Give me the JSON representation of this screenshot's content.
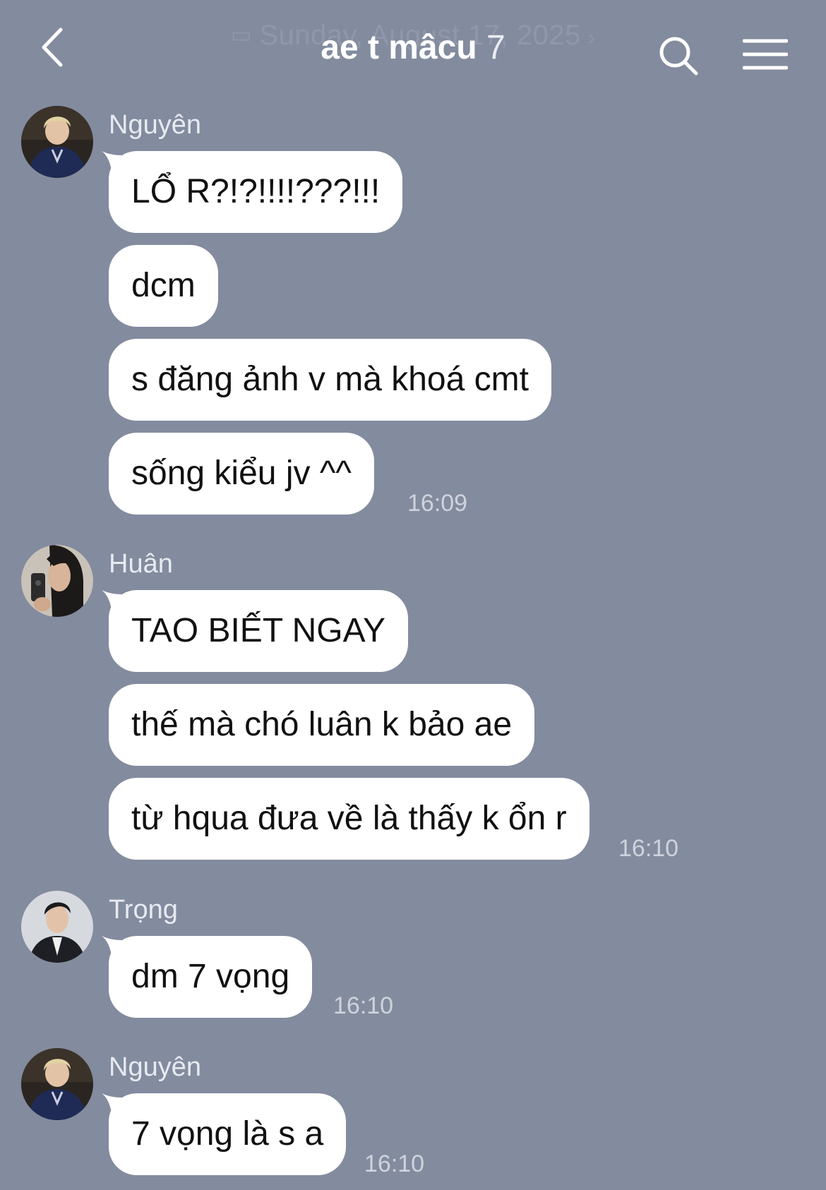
{
  "header": {
    "date_label": "Sunday, August 17, 2025",
    "title": "ae t mâcu",
    "member_count": "7"
  },
  "icons": {
    "back": "chevron-left-icon",
    "search": "search-icon",
    "menu": "hamburger-menu-icon",
    "calendar": "calendar-icon"
  },
  "messages": [
    {
      "sender": "Nguyên",
      "avatar": "avatar-nguyen",
      "bubbles": [
        "LỔ R?!?!!!!???!!!",
        "dcm",
        "s đăng ảnh v mà khoá cmt",
        "sống kiểu jv ^^"
      ],
      "time": "16:09"
    },
    {
      "sender": "Huân",
      "avatar": "avatar-huan",
      "bubbles": [
        "TAO BIẾT NGAY",
        "thế mà chó luân k bảo ae",
        "từ hqua đưa về là thấy k ổn r"
      ],
      "time": "16:10"
    },
    {
      "sender": "Trọng",
      "avatar": "avatar-trong",
      "bubbles": [
        "dm 7 vọng"
      ],
      "time": "16:10"
    },
    {
      "sender": "Nguyên",
      "avatar": "avatar-nguyen",
      "bubbles": [
        "7 vọng là s a"
      ],
      "time": "16:10"
    }
  ],
  "colors": {
    "background": "#838b9e",
    "bubble": "#ffffff",
    "text": "#111111",
    "meta_text": "#cfd3dd"
  }
}
